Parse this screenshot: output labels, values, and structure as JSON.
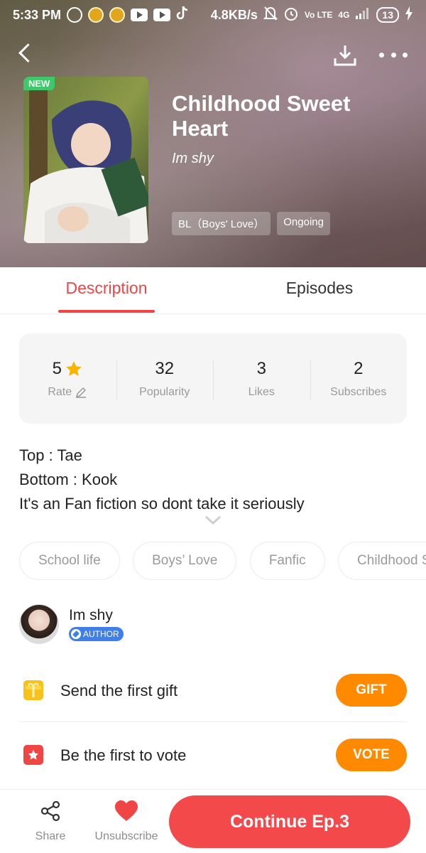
{
  "status_bar": {
    "time": "5:33 PM",
    "net_speed": "4.8KB/s",
    "volte": "Vo LTE",
    "network": "4G",
    "battery": "13"
  },
  "book": {
    "new_badge": "NEW",
    "title": "Childhood Sweet Heart",
    "author": "Im shy",
    "genre_chip": "BL（Boys' Love）",
    "status_chip": "Ongoing"
  },
  "tabs": [
    {
      "label": "Description"
    },
    {
      "label": "Episodes"
    }
  ],
  "stats": [
    {
      "value": "5",
      "label": "Rate"
    },
    {
      "value": "32",
      "label": "Popularity"
    },
    {
      "value": "3",
      "label": "Likes"
    },
    {
      "value": "2",
      "label": "Subscribes"
    }
  ],
  "description": [
    "Top : Tae",
    "Bottom : Kook",
    "It's an Fan fiction so dont take it seriously"
  ],
  "tags": [
    "School life",
    "Boys’ Love",
    "Fanfic",
    "Childhood S"
  ],
  "author_row": {
    "name": "Im shy",
    "badge": "AUTHOR"
  },
  "actions": {
    "gift_text": "Send the first gift",
    "gift_button": "GIFT",
    "vote_text": "Be the first to vote",
    "vote_button": "VOTE"
  },
  "bottom_bar": {
    "share_label": "Share",
    "unsubscribe_label": "Unsubscribe",
    "continue_label": "Continue Ep.3"
  },
  "colors": {
    "accent_red": "#f04545",
    "action_orange": "#ff8a00",
    "new_green": "#3ec86a",
    "author_blue": "#3f7fe6",
    "star_yellow": "#f7b500"
  }
}
